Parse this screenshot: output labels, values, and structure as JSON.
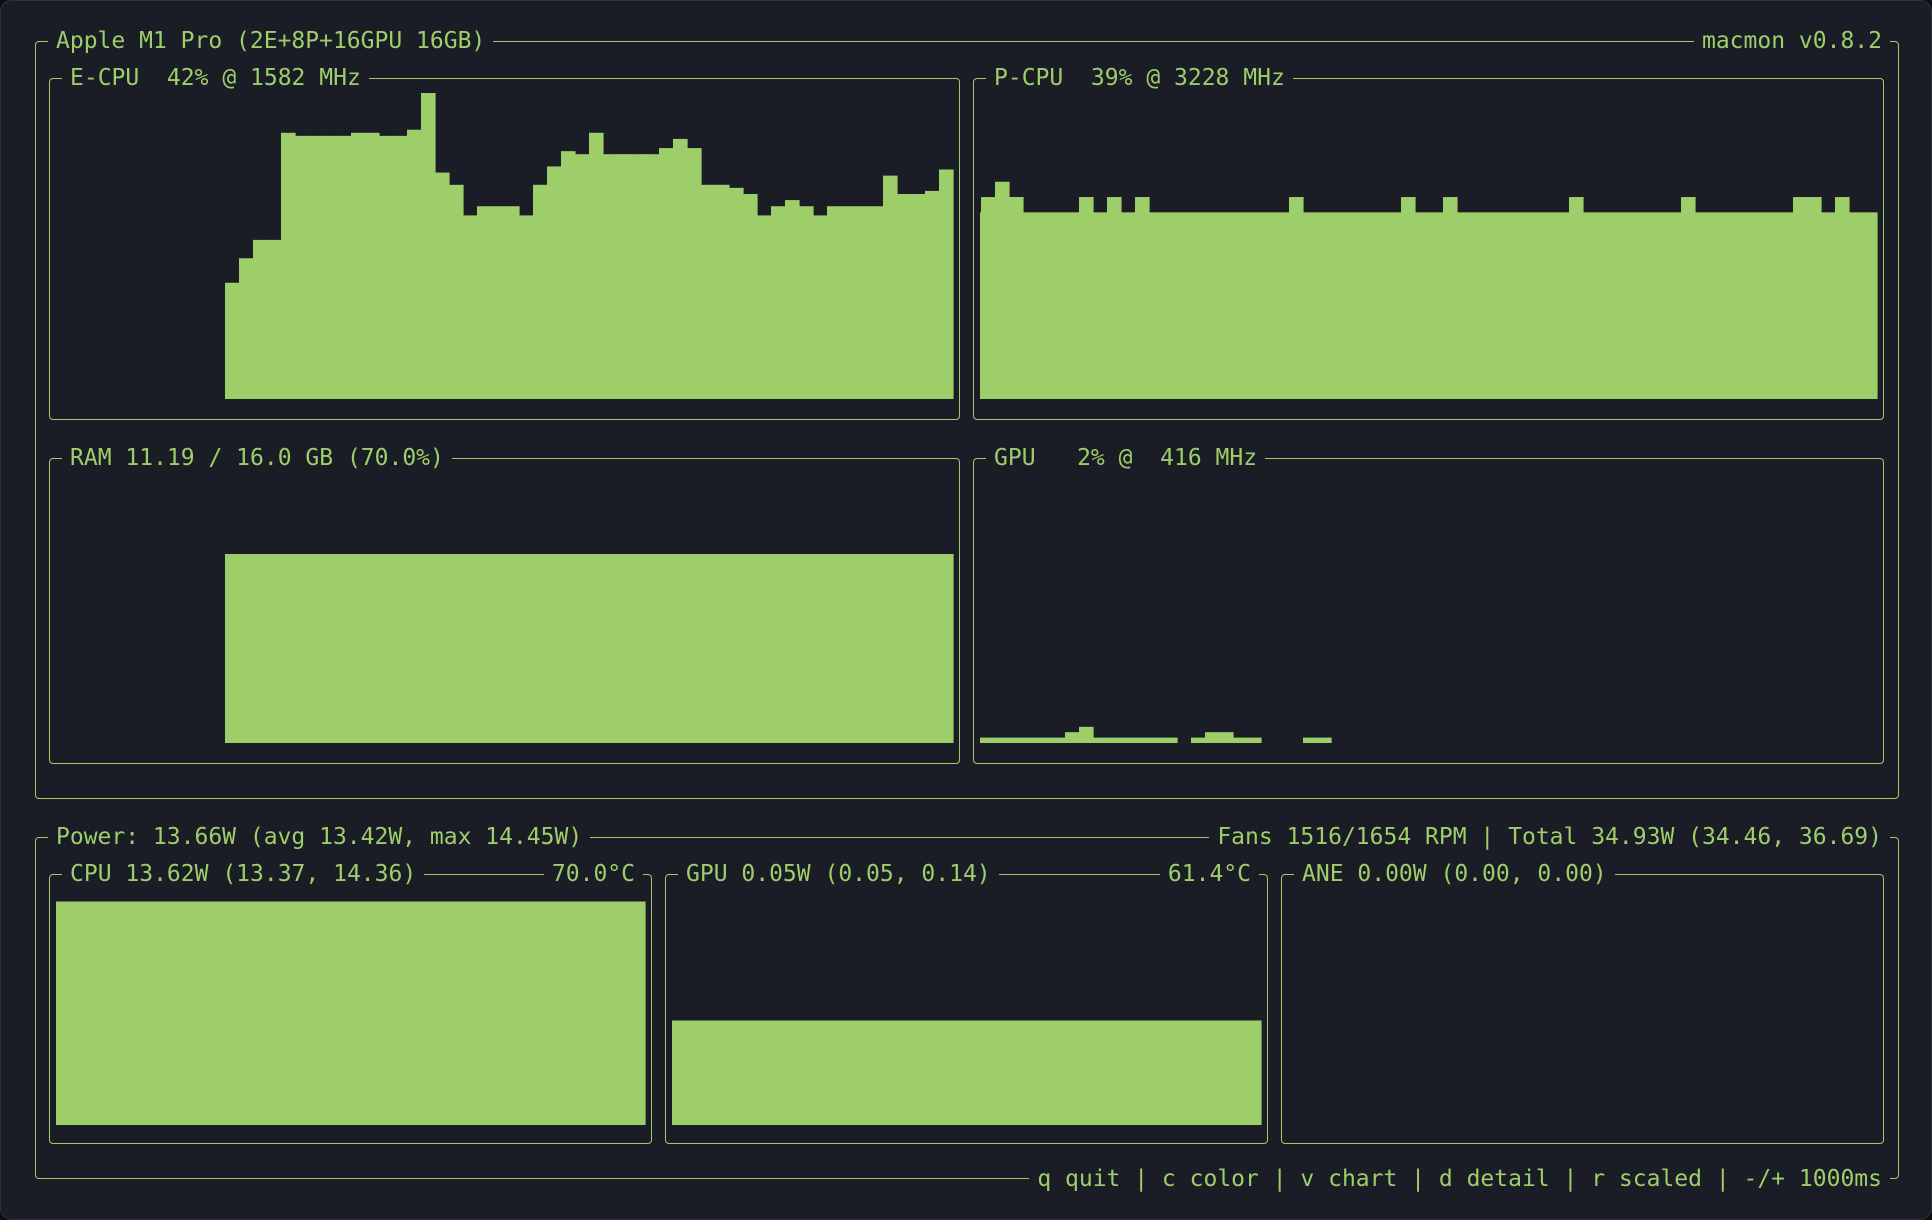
{
  "theme": {
    "background": "#1a1c26",
    "accent": "#9ece6a"
  },
  "header": {
    "device": "Apple M1 Pro (2E+8P+16GPU 16GB)",
    "version": "macmon v0.8.2"
  },
  "panels": {
    "ecpu": {
      "title": "E-CPU  42% @ 1582 MHz"
    },
    "pcpu": {
      "title": "P-CPU  39% @ 3228 MHz"
    },
    "ram": {
      "title": "RAM 11.19 / 16.0 GB (70.0%)"
    },
    "gpu": {
      "title": "GPU   2% @  416 MHz"
    }
  },
  "power": {
    "title": "Power: 13.66W (avg 13.42W, max 14.45W)",
    "summary": "Fans 1516/1654 RPM | Total 34.93W (34.46, 36.69)",
    "cpu": {
      "title": "CPU 13.62W (13.37, 14.36)",
      "temp": "70.0°C"
    },
    "gpu": {
      "title": "GPU 0.05W (0.05, 0.14)",
      "temp": "61.4°C"
    },
    "ane": {
      "title": "ANE 0.00W (0.00, 0.00)"
    }
  },
  "footer": {
    "shortcuts": "q quit | c color | v chart | d detail | r scaled | -/+ 1000ms"
  },
  "chart_data": [
    {
      "id": "ecpu",
      "type": "bar",
      "title": "E-CPU  42% @ 1582 MHz",
      "ylim": [
        0,
        100
      ],
      "values": [
        38,
        46,
        52,
        52,
        87,
        86,
        86,
        86,
        86,
        87,
        87,
        86,
        86,
        88,
        100,
        74,
        70,
        60,
        63,
        63,
        63,
        60,
        70,
        76,
        81,
        80,
        87,
        80,
        80,
        80,
        80,
        82,
        85,
        82,
        70,
        70,
        69,
        67,
        60,
        63,
        65,
        63,
        60,
        63,
        63,
        63,
        63,
        73,
        67,
        67,
        68,
        75
      ]
    },
    {
      "id": "pcpu",
      "type": "bar",
      "title": "P-CPU  39% @ 3228 MHz",
      "ylim": [
        0,
        100
      ],
      "values": [
        61,
        66,
        61,
        61,
        61,
        61,
        66,
        71,
        66,
        61,
        61,
        61,
        61,
        66,
        61,
        66,
        61,
        66,
        61,
        61,
        61,
        61,
        61,
        61,
        61,
        61,
        61,
        61,
        66,
        61,
        61,
        61,
        61,
        61,
        61,
        61,
        66,
        61,
        61,
        66,
        61,
        61,
        61,
        61,
        61,
        61,
        61,
        61,
        66,
        61,
        61,
        61,
        61,
        61,
        61,
        61,
        66,
        61,
        61,
        61,
        61,
        61,
        61,
        61,
        66,
        66,
        61,
        66,
        61,
        61
      ]
    },
    {
      "id": "ram",
      "type": "bar",
      "title": "RAM 11.19 / 16.0 GB (70.0%)",
      "ylim": [
        0,
        100
      ],
      "values": [
        70,
        70,
        70,
        70,
        70,
        70,
        70,
        70,
        70,
        70,
        70,
        70,
        70,
        70,
        70,
        70,
        70,
        70,
        70,
        70,
        70,
        70,
        70,
        70,
        70,
        70,
        70,
        70,
        70,
        70,
        70,
        70,
        70,
        70,
        70,
        70,
        70,
        70,
        70,
        70,
        70,
        70,
        70,
        70,
        70,
        70,
        70,
        70,
        70,
        70,
        70,
        70
      ]
    },
    {
      "id": "gpu",
      "type": "bar",
      "title": "GPU   2% @  416 MHz",
      "ylim": [
        0,
        100
      ],
      "values": [
        4,
        4,
        4,
        2,
        2,
        2,
        2,
        2,
        2,
        2,
        2,
        2,
        4,
        6,
        2,
        2,
        2,
        2,
        2,
        2,
        0,
        2,
        4,
        4,
        2,
        2,
        0,
        0,
        0,
        2,
        2,
        0,
        0,
        0,
        0,
        0,
        0,
        0,
        0,
        0,
        0,
        0,
        0,
        0,
        0,
        0,
        0,
        0,
        0,
        0,
        0,
        0,
        0,
        0,
        0,
        0,
        0,
        0,
        0,
        0,
        0,
        0,
        0,
        0,
        0,
        0,
        0,
        0,
        0,
        0
      ]
    },
    {
      "id": "cpu-power",
      "type": "bar",
      "title": "CPU 13.62W (13.37, 14.36)",
      "ylim": [
        0,
        14.36
      ],
      "values": [
        13.7,
        13.4,
        13.6,
        13.6,
        13.6,
        13.7,
        13.4,
        14.3,
        13.4,
        13.4,
        13.4,
        13.4,
        13.6,
        13.6,
        13.4,
        13.6,
        13.6,
        13.4,
        13.6,
        13.4,
        13.6,
        13.6,
        13.4,
        13.4,
        13.4,
        13.4,
        13.4,
        13.4,
        13.4,
        13.4,
        13.6,
        13.6,
        13.4,
        13.4,
        13.4,
        13.4,
        13.4,
        13.4,
        13.4,
        13.4,
        13.4,
        13.4,
        13.4,
        13.4,
        13.6,
        13.6,
        13.4,
        13.4,
        13.4,
        13.4,
        13.4,
        13.4,
        13.6,
        13.6,
        13.4,
        13.6,
        13.6,
        13.4,
        13.4,
        13.4,
        13.4,
        13.6,
        13.6,
        13.4,
        13.4,
        13.4,
        13.4,
        13.4,
        13.4,
        13.6,
        13.6,
        13.4,
        13.6,
        13.6,
        13.4,
        13.6,
        13.4,
        13.6,
        13.6,
        13.4,
        13.4,
        13.7,
        13.6,
        13.6,
        13.4,
        13.4,
        13.4,
        13.4,
        13.4,
        13.6,
        13.6,
        13.4,
        13.4,
        13.4,
        13.6,
        13.6,
        13.6,
        13.6,
        13.6,
        13.6,
        13.6,
        13.6,
        13.6,
        13.6,
        13.6,
        13.6,
        13.6,
        13.6,
        13.6,
        13.6,
        13.6,
        13.6,
        13.6,
        13.6,
        13.6,
        13.6,
        13.6,
        13.6,
        13.6,
        13.6,
        13.6,
        13.6,
        13.6,
        13.6,
        13.6,
        13.6,
        13.6,
        13.6,
        13.6,
        13.6,
        13.6,
        13.6,
        13.6,
        13.6,
        13.6,
        13.6,
        13.6,
        13.6,
        13.6,
        13.6,
        13.6,
        13.6,
        13.6,
        13.6,
        13.6,
        13.6,
        13.6,
        13.6,
        13.6,
        13.6,
        13.6,
        13.6,
        13.6,
        13.6,
        13.6,
        13.6,
        13.6,
        13.6,
        13.6,
        13.6,
        13.6,
        13.6,
        13.6,
        13.6,
        13.6,
        13.6,
        13.6,
        13.6,
        13.6,
        13.6,
        13.6,
        13.6,
        13.6,
        13.6,
        13.6,
        13.6,
        13.6,
        13.6,
        13.6,
        13.6,
        13.6,
        13.6,
        13.6,
        13.6,
        13.6,
        13.6,
        13.6,
        13.6,
        13.6,
        13.6,
        13.6,
        13.6,
        13.6,
        13.6,
        13.6,
        13.6,
        13.6,
        13.6,
        13.6,
        13.6,
        13.6,
        13.6,
        13.6,
        13.6,
        13.6,
        13.6,
        13.6,
        13.6,
        13.6,
        13.6,
        13.6,
        13.6,
        13.6,
        13.6,
        13.6,
        13.6,
        13.6,
        13.6,
        13.6,
        13.6,
        13.6,
        13.6,
        13.6,
        13.6,
        13.6,
        13.6,
        13.6,
        13.6,
        13.6,
        13.6,
        13.6,
        13.6,
        13.6,
        13.6,
        13.6,
        13.6,
        13.6,
        13.6,
        13.6,
        13.6,
        13.6,
        13.6,
        13.6,
        13.6,
        13.6
      ]
    },
    {
      "id": "gpu-power",
      "type": "bar",
      "title": "GPU 0.05W (0.05, 0.14)",
      "ylim": [
        0,
        0.14
      ],
      "values": [
        0.102,
        0.062,
        0.055,
        0.055,
        0.055,
        0.06,
        0.087,
        0.087,
        0.11,
        0.133,
        0.062,
        0.062,
        0.062,
        0.062,
        0.062,
        0.062,
        0.062,
        0.062,
        0.062,
        0.062,
        0.062,
        0.062,
        0.062,
        0.062,
        0.062,
        0.062,
        0.062,
        0.062,
        0.062,
        0.062,
        0.062,
        0.062,
        0.062,
        0.062,
        0.062,
        0.062,
        0.062,
        0.062,
        0.062,
        0.062,
        0.062,
        0.062,
        0.062,
        0.062,
        0.062,
        0.062,
        0.062,
        0.062,
        0.062,
        0.062,
        0.062,
        0.062,
        0.062,
        0.062,
        0.062,
        0.062,
        0.062,
        0.062,
        0.062,
        0.062,
        0.062,
        0.062,
        0.062,
        0.062,
        0.062,
        0.062,
        0.062,
        0.062,
        0.062,
        0.062,
        0.062,
        0.062,
        0.062,
        0.062,
        0.062,
        0.062,
        0.062,
        0.062,
        0.062,
        0.062,
        0.062,
        0.062,
        0.062,
        0.062,
        0.062,
        0.062,
        0.062,
        0.062,
        0.062,
        0.062,
        0.062,
        0.062,
        0.062,
        0.062,
        0.062,
        0.062,
        0.062,
        0.062,
        0.062,
        0.062,
        0.062,
        0.062,
        0.062,
        0.062,
        0.062,
        0.062,
        0.062,
        0.062,
        0.062,
        0.062,
        0.062,
        0.062,
        0.062,
        0.062,
        0.062,
        0.062,
        0.062,
        0.062,
        0.062,
        0.062,
        0.062,
        0.062,
        0.062,
        0.062,
        0.062,
        0.062,
        0.062,
        0.062,
        0.062,
        0.062,
        0.062,
        0.062,
        0.062,
        0.062,
        0.062,
        0.062,
        0.062,
        0.062,
        0.062,
        0.062,
        0.062,
        0.062,
        0.062,
        0.062,
        0.062,
        0.062,
        0.062,
        0.062,
        0.062,
        0.062,
        0.062,
        0.062,
        0.062,
        0.062,
        0.062,
        0.062,
        0.062,
        0.062,
        0.062,
        0.062,
        0.062,
        0.062,
        0.062,
        0.062,
        0.062,
        0.062,
        0.062,
        0.062,
        0.062,
        0.062,
        0.062,
        0.062,
        0.062,
        0.062,
        0.062,
        0.062,
        0.062,
        0.062,
        0.062,
        0.062,
        0.062,
        0.062,
        0.062,
        0.062,
        0.062,
        0.062,
        0.062,
        0.062,
        0.062,
        0.062,
        0.062,
        0.062,
        0.062,
        0.062,
        0.062,
        0.062,
        0.062,
        0.062,
        0.062,
        0.062,
        0.062,
        0.062,
        0.062,
        0.062,
        0.062,
        0.062,
        0.062,
        0.062,
        0.062,
        0.062,
        0.062,
        0.062,
        0.062,
        0.062,
        0.062,
        0.062,
        0.062,
        0.062,
        0.062,
        0.062,
        0.062,
        0.062,
        0.062,
        0.062,
        0.062,
        0.062,
        0.062,
        0.062,
        0.062,
        0.062,
        0.062,
        0.062,
        0.062,
        0.062,
        0.062
      ]
    },
    {
      "id": "ane-power",
      "type": "bar",
      "title": "ANE 0.00W (0.00, 0.00)",
      "ylim": [
        0,
        1
      ],
      "values": []
    }
  ]
}
